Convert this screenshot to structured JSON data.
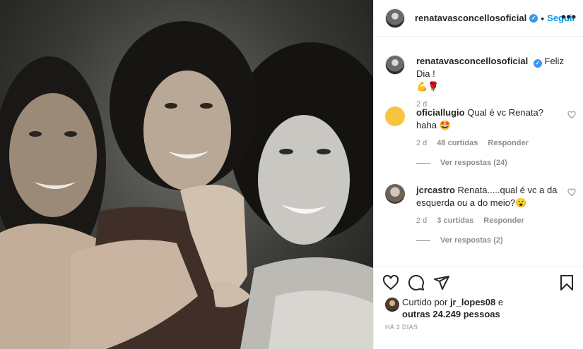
{
  "header": {
    "username": "renatavasconcellosoficial",
    "separator": "•",
    "follow_label": "Seguir",
    "more_label": "•••"
  },
  "caption": {
    "username": "renatavasconcellosoficial",
    "text": "Feliz Dia !",
    "emoji": "💪🌹",
    "time": "2 d"
  },
  "comments": [
    {
      "username": "oficiallugio",
      "text": "Qual é vc Renata? haha 🤩",
      "time": "2 d",
      "likes": "48 curtidas",
      "reply_label": "Responder",
      "view_replies": "Ver respostas (24)",
      "avatar_color": "#f5c542"
    },
    {
      "username": "jcrcastro",
      "text": "Renata.....qual é vc a da esquerda ou a do meio?😮",
      "time": "2 d",
      "likes": "3 curtidas",
      "reply_label": "Responder",
      "view_replies": "Ver respostas (2)",
      "avatar_color": "#8a7a6a"
    }
  ],
  "likes": {
    "prefix": "Curtido por",
    "user": "jr_lopes08",
    "connector": "e",
    "others": "outras 24.249 pessoas"
  },
  "posted_ago": "HÁ 2 DIAS",
  "icons": [
    "heart-icon",
    "comment-icon",
    "share-icon",
    "bookmark-icon",
    "verified-icon",
    "more-icon"
  ],
  "colors": {
    "accent": "#0095f6",
    "verified": "#3897f0",
    "muted": "#8e8e8e",
    "text": "#262626"
  }
}
